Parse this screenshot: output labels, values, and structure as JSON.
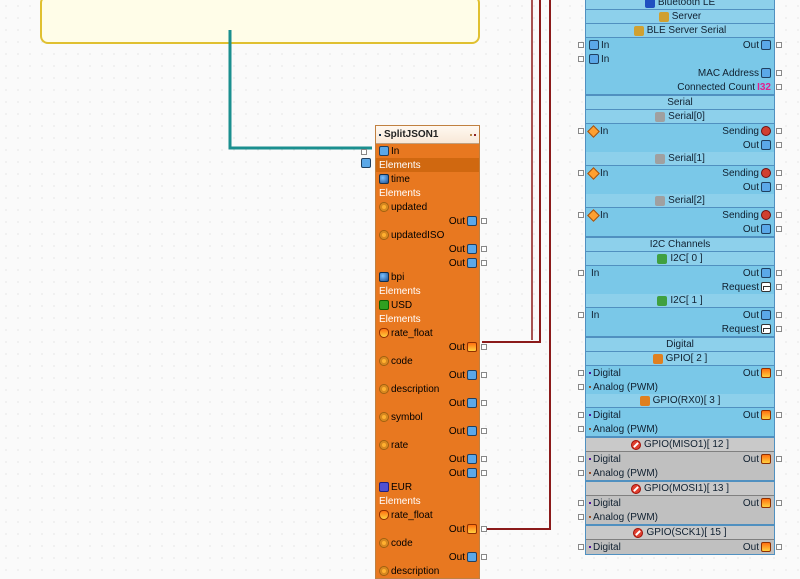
{
  "splitjson": {
    "title": "SplitJSON1",
    "in_label": "In",
    "elements_label": "Elements",
    "time_label": "time",
    "updated": "updated",
    "updatedISO": "updatedISO",
    "bpi": "bpi",
    "usd": "USD",
    "rate_float": "rate_float",
    "code": "code",
    "description": "description",
    "symbol": "symbol",
    "rate": "rate",
    "eur": "EUR",
    "out_label": "Out"
  },
  "hw": {
    "ble": "Bluetooth LE",
    "server": "Server",
    "ble_serial": "BLE Server Serial",
    "in": "In",
    "out": "Out",
    "mac": "MAC Address",
    "connected": "Connected Count",
    "connected_val": "I32",
    "serial_hdr": "Serial",
    "serial0": "Serial[0]",
    "serial1": "Serial[1]",
    "serial2": "Serial[2]",
    "sending": "Sending",
    "i2c_hdr": "I2C Channels",
    "i2c0": "I2C[ 0 ]",
    "i2c1": "I2C[ 1 ]",
    "request": "Request",
    "digital_hdr": "Digital",
    "gpio2": "GPIO[ 2 ]",
    "gpio_rx0_3": "GPIO(RX0)[ 3 ]",
    "gpio_miso1_12": "GPIO(MISO1)[ 12 ]",
    "gpio_mosi1_13": "GPIO(MOSI1)[ 13 ]",
    "gpio_sck1_15": "GPIO(SCK1)[ 15 ]",
    "digital": "Digital",
    "analog_pwm": "Analog (PWM)"
  }
}
